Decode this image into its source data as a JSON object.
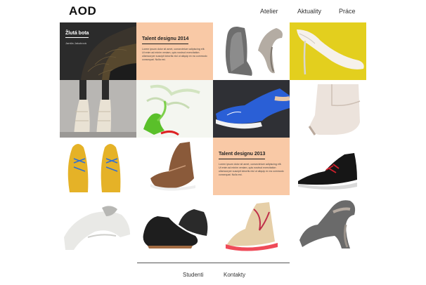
{
  "header": {
    "logo": "AOD",
    "nav": [
      "Atelier",
      "Aktuality",
      "Práce"
    ]
  },
  "tiles": {
    "featured": {
      "title": "Žlutá bota",
      "author": "Jamila Jakubová"
    },
    "talent_2014": {
      "title": "Talent designu 2014",
      "body": "Lorem ipsum dolor sit amet, consectetuer adipiscing elit. Ut enim ad minim veniam, quis nostrud exercitation ullamcorper suscipit lobortis nisl ut aliquip ex ea commodo consequat. Nulla est."
    },
    "talent_2013": {
      "title": "Talent designu 2013",
      "body": "Lorem ipsum dolor sit amet, consectetuer adipiscing elit. Ut enim ad minim veniam, quis nostrud exercitation ullamcorper suscipit lobortis nisl ut aliquip ex ea commodo consequat. Nulla est."
    },
    "shoe_names": [
      "grey-sculptural-heel",
      "yellow-stiletto",
      "white-strappy-sandal",
      "green-ribbon-shoe",
      "blue-sneaker",
      "nude-ankle-boot",
      "yellow-oxfords",
      "brown-sneaker-boot",
      "black-red-sneaker",
      "white-platform-shoe",
      "black-leather-shoes",
      "painted-sneaker",
      "grey-heel-side"
    ]
  },
  "footer": {
    "links": [
      "Studenti",
      "Kontakty"
    ]
  },
  "colors": {
    "accent_peach": "#f9c9a6",
    "dark_tile": "#2e2e2e"
  }
}
